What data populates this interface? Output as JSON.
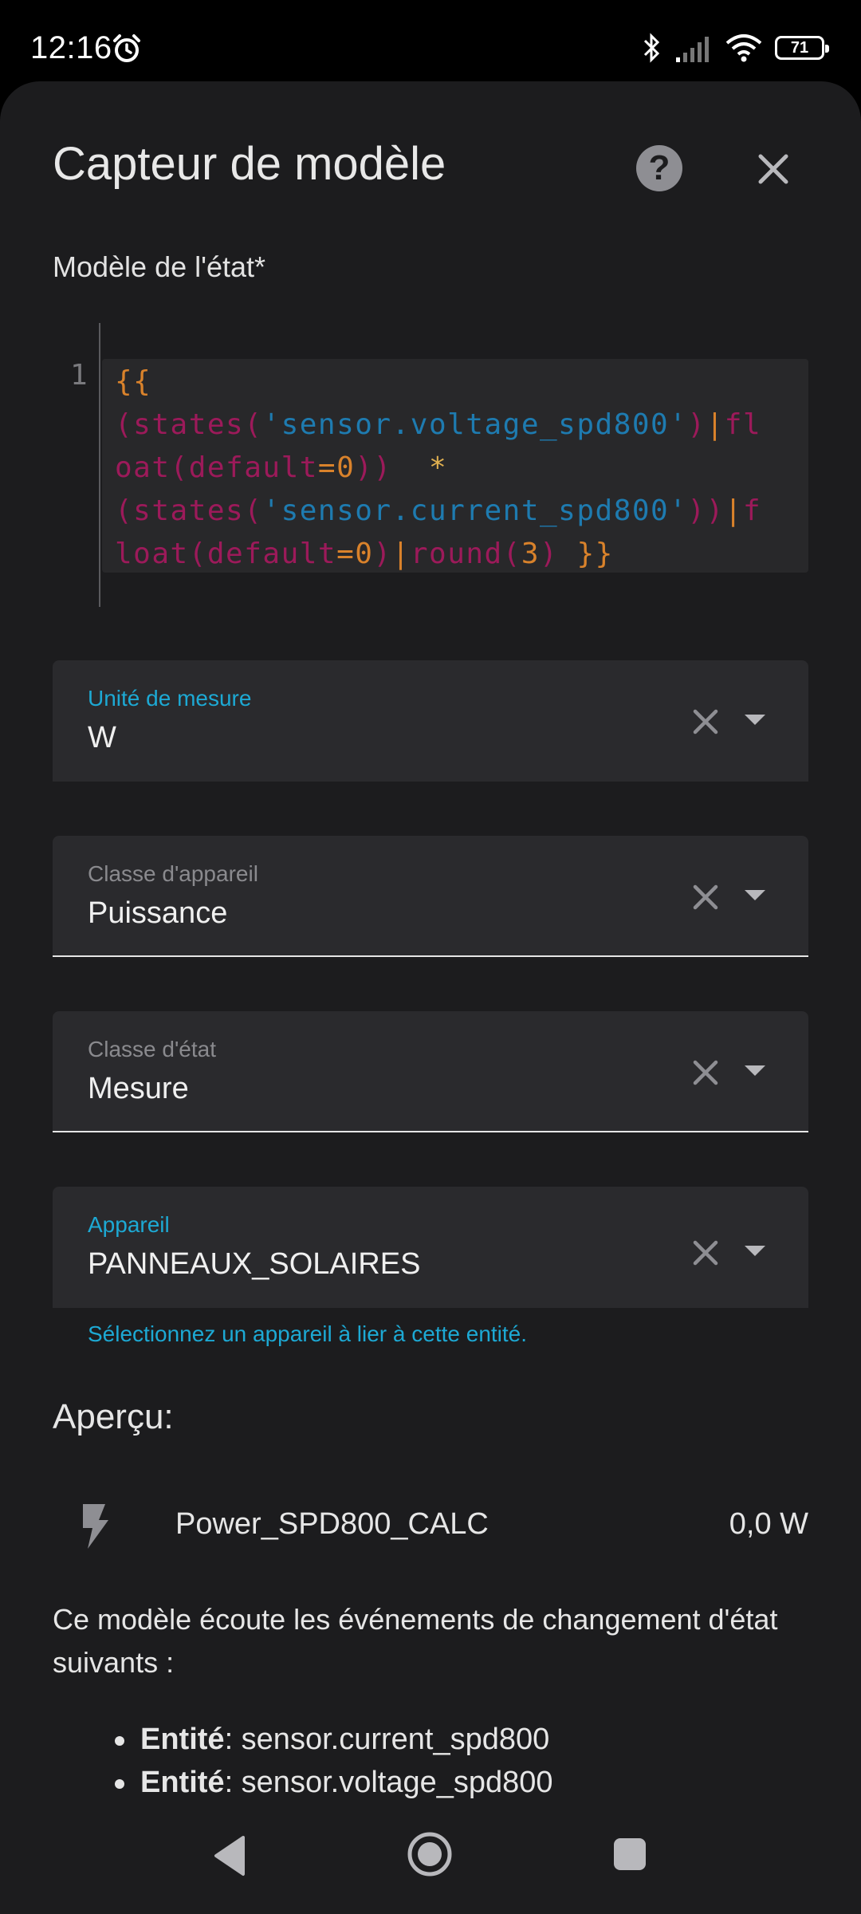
{
  "status_bar": {
    "time": "12:16",
    "battery": "71"
  },
  "dialog": {
    "title": "Capteur de modèle",
    "state_template_label": "Modèle de l'état*",
    "code_line_number": "1"
  },
  "fields": {
    "unit": {
      "label": "Unité de mesure",
      "value": "W"
    },
    "device_class": {
      "label": "Classe d'appareil",
      "value": "Puissance"
    },
    "state_class": {
      "label": "Classe d'état",
      "value": "Mesure"
    },
    "device": {
      "label": "Appareil",
      "value": "PANNEAUX_SOLAIRES",
      "helper": "Sélectionnez un appareil à lier à cette entité."
    }
  },
  "preview": {
    "label": "Aperçu:",
    "entity_name": "Power_SPD800_CALC",
    "entity_value": "0,0 W",
    "icon": "flash-icon"
  },
  "listeners": {
    "text": "Ce modèle écoute les événements de changement d'état suivants :",
    "items": [
      {
        "prefix": "Entité",
        "value": ": sensor.current_spd800"
      },
      {
        "prefix": "Entité",
        "value": ": sensor.voltage_spd800"
      }
    ]
  },
  "colors": {
    "accent": "#1da9d4",
    "background": "#1c1c1e",
    "field": "#2a2a2d"
  }
}
